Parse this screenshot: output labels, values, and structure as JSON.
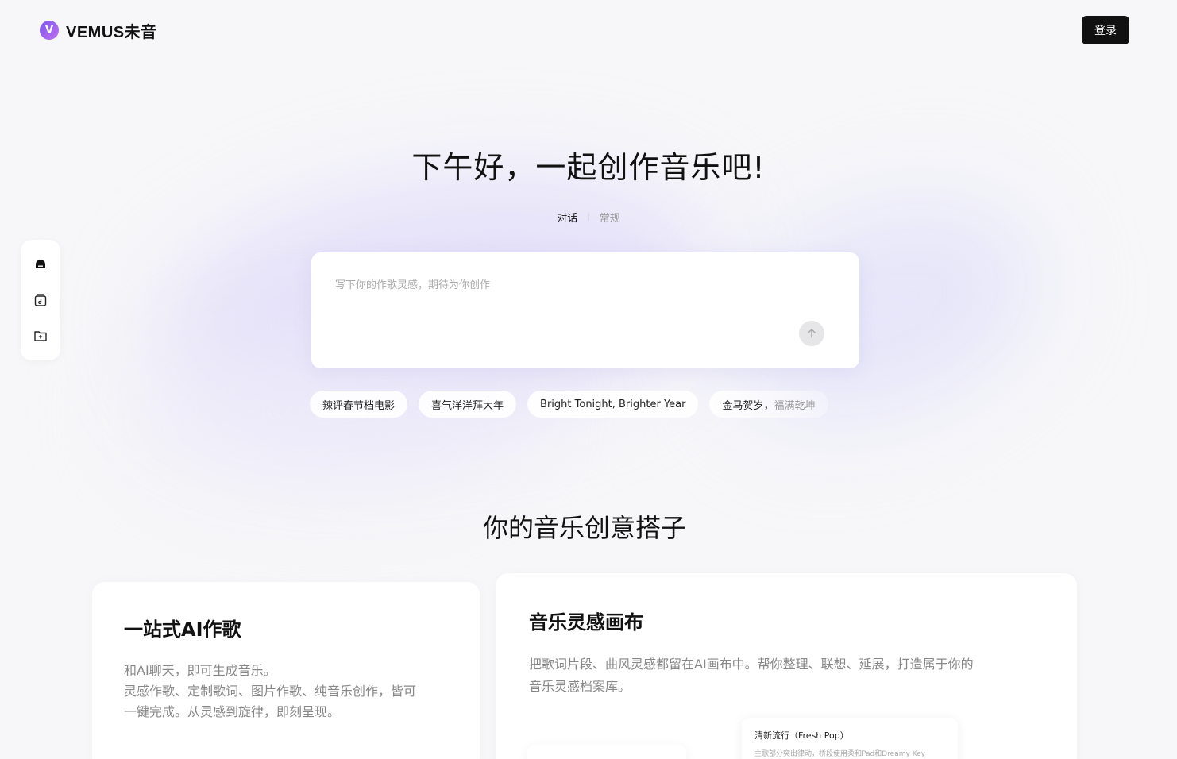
{
  "header": {
    "logo_text": "VEMUS未音",
    "login_label": "登录"
  },
  "side_nav": {
    "items": [
      {
        "icon": "home-icon"
      },
      {
        "icon": "music-library-icon"
      },
      {
        "icon": "folder-add-icon"
      }
    ]
  },
  "hero": {
    "title": "下午好，一起创作音乐吧!",
    "modes": [
      "对话",
      "常规"
    ],
    "active_mode": "对话"
  },
  "composer": {
    "placeholder": "写下你的作歌灵感，期待为你创作",
    "value": ""
  },
  "suggestions": [
    "辣评春节档电影",
    "喜气洋洋拜大年",
    "Bright Tonight, Brighter Year",
    "金马贺岁，",
    "福满乾坤"
  ],
  "features": {
    "section_title": "你的音乐创意搭子",
    "cards": [
      {
        "title": "一站式AI作歌",
        "lines": [
          "和AI聊天，即可生成音乐。",
          "灵感作歌、定制歌词、图片作歌、纯音乐创作，皆可",
          "一键完成。从灵感到旋律，即刻呈现。"
        ]
      },
      {
        "title": "音乐灵感画布",
        "lines": [
          "把歌词片段、曲风灵感都留在AI画布中。帮你整理、联想、延展，打造属于你的",
          "音乐灵感档案库。"
        ],
        "preview": {
          "title": "清新流行（Fresh Pop）",
          "subtitle": "主歌部分突出律动，桥段使用柔和Pad和Dreamy Key"
        }
      }
    ]
  },
  "colors": {
    "accent": "#7b5cf0",
    "button_dark": "#111111",
    "background": "#f7f7f9"
  }
}
